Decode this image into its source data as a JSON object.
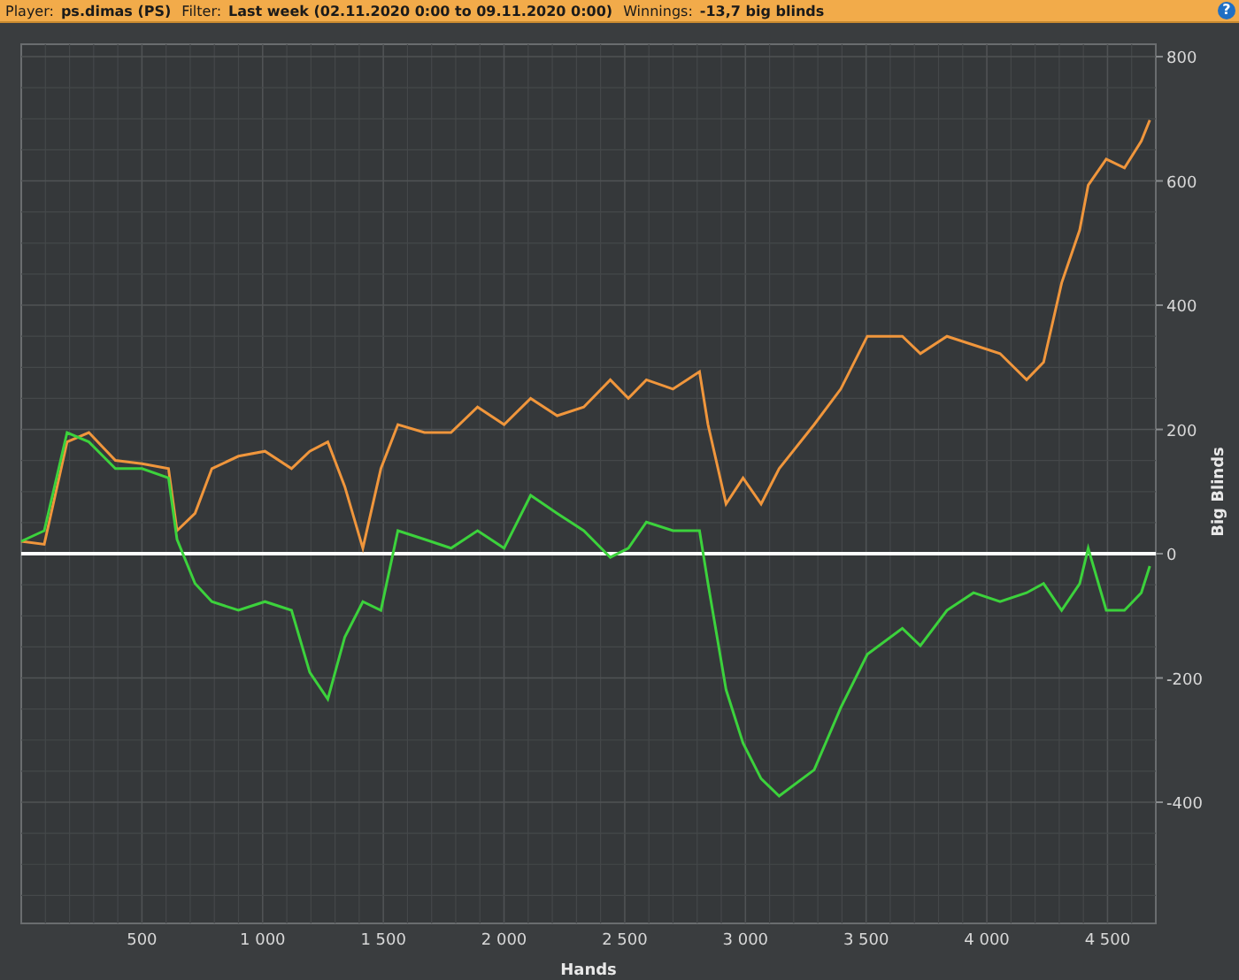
{
  "header": {
    "fields": [
      {
        "label": "Player:",
        "value": "ps.dimas (PS)"
      },
      {
        "label": "Filter:",
        "value": "Last week (02.11.2020 0:00 to 09.11.2020 0:00)"
      },
      {
        "label": "Winnings:",
        "value": "-13,7 big blinds"
      }
    ],
    "help_button": "?"
  },
  "chart": {
    "chart_data": {
      "type": "line",
      "grid": true,
      "xlabel": "Hands",
      "ylabel": "Big Blinds",
      "xlim": [
        0,
        4700
      ],
      "ylim": [
        -595,
        820
      ],
      "xticks": [
        500,
        {
          "value": 1000,
          "label": "1 000"
        },
        {
          "value": 1500,
          "label": "1 500"
        },
        {
          "value": 2000,
          "label": "2 000"
        },
        {
          "value": 2500,
          "label": "2 500"
        },
        {
          "value": 3000,
          "label": "3 000"
        },
        {
          "value": 3500,
          "label": "3 500"
        },
        {
          "value": 4000,
          "label": "4 000"
        },
        {
          "value": 4500,
          "label": "4 500"
        }
      ],
      "yticks": [
        800,
        600,
        400,
        200,
        0,
        -200,
        -400
      ],
      "x": [
        0,
        95,
        190,
        280,
        390,
        500,
        610,
        645,
        720,
        790,
        900,
        1010,
        1120,
        1195,
        1270,
        1340,
        1415,
        1490,
        1560,
        1670,
        1780,
        1890,
        2000,
        2110,
        2220,
        2330,
        2440,
        2515,
        2590,
        2700,
        2810,
        2845,
        2920,
        2990,
        3065,
        3140,
        3285,
        3395,
        3505,
        3650,
        3725,
        3835,
        3945,
        4055,
        4165,
        4235,
        4310,
        4385,
        4420,
        4495,
        4570,
        4640,
        4675
      ],
      "series": [
        {
          "color": "#f0963c",
          "values": [
            20,
            15,
            180,
            195,
            150,
            145,
            137,
            37,
            65,
            137,
            157,
            165,
            137,
            165,
            180,
            108,
            9,
            137,
            208,
            195,
            195,
            236,
            208,
            250,
            222,
            236,
            280,
            250,
            280,
            265,
            293,
            208,
            80,
            122,
            80,
            137,
            208,
            265,
            350,
            350,
            322,
            350,
            336,
            322,
            280,
            308,
            436,
            521,
            593,
            635,
            621,
            664,
            698
          ]
        },
        {
          "color": "#3cd23c",
          "values": [
            20,
            37,
            195,
            180,
            137,
            137,
            122,
            23,
            -48,
            -77,
            -91,
            -77,
            -91,
            -191,
            -234,
            -134,
            -77,
            -91,
            37,
            23,
            9,
            37,
            9,
            94,
            65,
            37,
            -6,
            9,
            51,
            37,
            37,
            -48,
            -219,
            -305,
            -362,
            -390,
            -348,
            -248,
            -162,
            -120,
            -148,
            -91,
            -63,
            -77,
            -63,
            -48,
            -91,
            -48,
            9,
            -91,
            -91,
            -63,
            -20
          ]
        }
      ]
    }
  }
}
